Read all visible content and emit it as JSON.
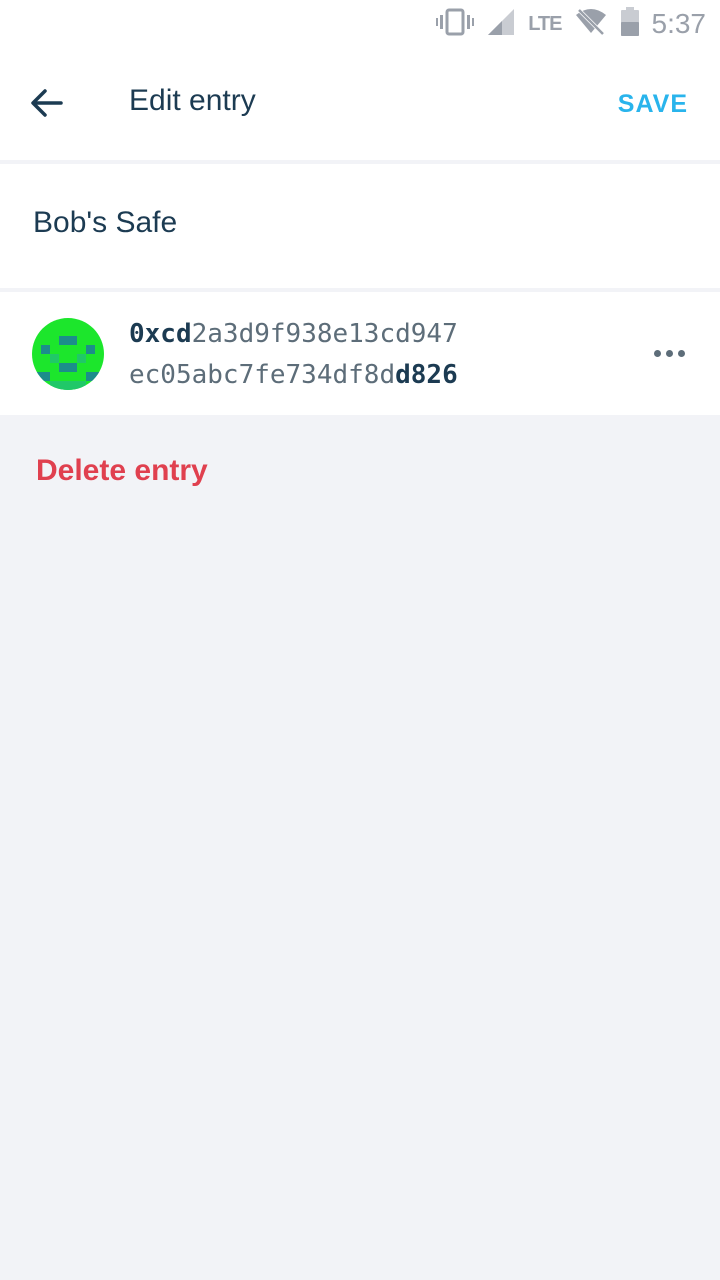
{
  "status_bar": {
    "time": "5:37",
    "network": "LTE",
    "icons": [
      "vibrate-icon",
      "signal-icon",
      "wifi-off-icon",
      "battery-icon"
    ]
  },
  "app_bar": {
    "back_icon": "arrow-back-icon",
    "title": "Edit entry",
    "save_label": "SAVE"
  },
  "entry": {
    "name": "Bob's Safe",
    "address": {
      "line1_strong": "0xcd",
      "line1_rest": "2a3d9f938e13cd947",
      "line2_rest": "ec05abc7fe734df8d",
      "line2_strong": "d826"
    },
    "more_icon": "more-horizontal-icon"
  },
  "delete_label": "Delete entry",
  "colors": {
    "accent": "#29b4ec",
    "danger": "#e0404f",
    "text_primary": "#1c3b52",
    "text_secondary": "#5d6d79",
    "background": "#f2f3f7",
    "identicon_bg": "#1ce62c",
    "identicon_fg": "#1c8d8b"
  }
}
